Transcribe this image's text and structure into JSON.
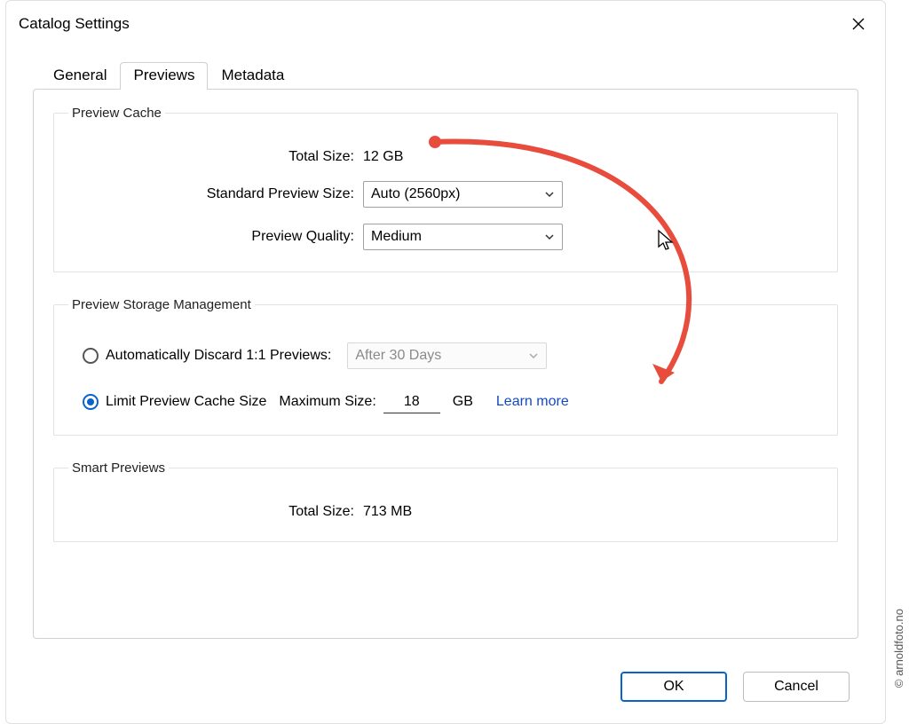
{
  "dialog": {
    "title": "Catalog Settings"
  },
  "tabs": {
    "general": "General",
    "previews": "Previews",
    "metadata": "Metadata"
  },
  "previewCache": {
    "legend": "Preview Cache",
    "totalSizeLabel": "Total Size:",
    "totalSizeValue": "12 GB",
    "standardSizeLabel": "Standard Preview Size:",
    "standardSizeValue": "Auto (2560px)",
    "qualityLabel": "Preview Quality:",
    "qualityValue": "Medium"
  },
  "storage": {
    "legend": "Preview Storage Management",
    "autoDiscardLabel": "Automatically Discard 1:1 Previews:",
    "autoDiscardValue": "After 30 Days",
    "limitLabel": "Limit Preview Cache Size",
    "maxLabel": "Maximum Size:",
    "maxValue": "18",
    "unit": "GB",
    "learnMore": "Learn more"
  },
  "smart": {
    "legend": "Smart Previews",
    "totalSizeLabel": "Total Size:",
    "totalSizeValue": "713 MB"
  },
  "buttons": {
    "ok": "OK",
    "cancel": "Cancel"
  },
  "watermark": "© arnoldfoto.no"
}
